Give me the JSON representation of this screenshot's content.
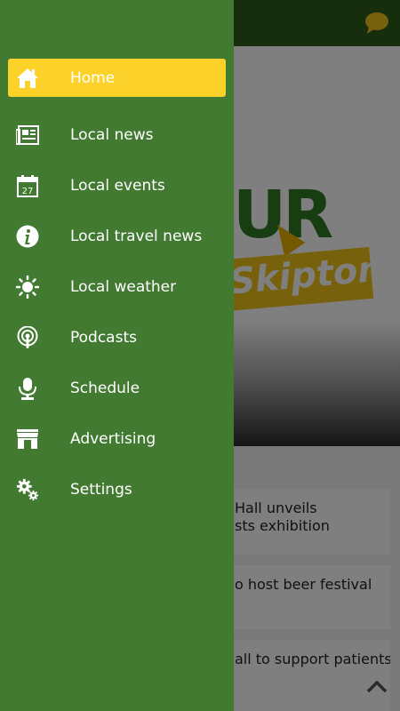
{
  "app": {
    "colors": {
      "drawer": "#427a31",
      "active": "#fcd22a",
      "topbar": "#2f5d1c"
    },
    "logo": {
      "ur": "UR",
      "town": "Skipton"
    },
    "news": [
      {
        "line1": "Hall unveils",
        "line2": "sts exhibition"
      },
      {
        "line1": "o host beer festival",
        "line2": ""
      },
      {
        "line1": "all to support patients",
        "line2": ""
      }
    ]
  },
  "menu": {
    "items": [
      {
        "label": "Home",
        "icon": "home-icon",
        "active": true
      },
      {
        "label": "Local news",
        "icon": "newspaper-icon"
      },
      {
        "label": "Local events",
        "icon": "calendar-icon",
        "calendar_day": "27"
      },
      {
        "label": "Local travel news",
        "icon": "info-icon"
      },
      {
        "label": "Local weather",
        "icon": "sun-icon"
      },
      {
        "label": "Podcasts",
        "icon": "podcast-icon"
      },
      {
        "label": "Schedule",
        "icon": "microphone-icon"
      },
      {
        "label": "Advertising",
        "icon": "storefront-icon"
      },
      {
        "label": "Settings",
        "icon": "gears-icon"
      }
    ]
  }
}
